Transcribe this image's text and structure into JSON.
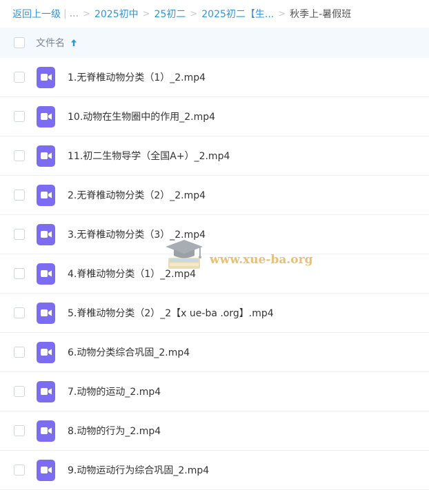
{
  "breadcrumb": {
    "back": "返回上一级",
    "pipe": "|",
    "ellipsis": "...",
    "separator": ">",
    "items": [
      "2025初中",
      "25初二",
      "2025初二【生..."
    ],
    "current": "秋季上-暑假班"
  },
  "header": {
    "column_name": "文件名",
    "sort_icon": "arrow-up-icon",
    "background": "#f4f9fd"
  },
  "files": [
    {
      "name": "1.无脊椎动物分类（1）_2.mp4",
      "icon": "video-file-icon"
    },
    {
      "name": "10.动物在生物圈中的作用_2.mp4",
      "icon": "video-file-icon"
    },
    {
      "name": "11.初二生物导学（全国A+）_2.mp4",
      "icon": "video-file-icon"
    },
    {
      "name": "2.无脊椎动物分类（2）_2.mp4",
      "icon": "video-file-icon"
    },
    {
      "name": "3.无脊椎动物分类（3）_2.mp4",
      "icon": "video-file-icon"
    },
    {
      "name": "4.脊椎动物分类（1）_2.mp4",
      "icon": "video-file-icon"
    },
    {
      "name": "5.脊椎动物分类（2）_2【x ue-ba .org】.mp4",
      "icon": "video-file-icon"
    },
    {
      "name": "6.动物分类综合巩固_2.mp4",
      "icon": "video-file-icon"
    },
    {
      "name": "7.动物的运动_2.mp4",
      "icon": "video-file-icon"
    },
    {
      "name": "8.动物的行为_2.mp4",
      "icon": "video-file-icon"
    },
    {
      "name": "9.动物运动行为综合巩固_2.mp4",
      "icon": "video-file-icon"
    }
  ],
  "watermark": {
    "text": "www.xue-ba.org",
    "icon": "graduation-cap-book-icon"
  },
  "colors": {
    "link": "#2f95d8",
    "video_icon": "#7c6cf2",
    "watermark": "#e4b55c"
  }
}
